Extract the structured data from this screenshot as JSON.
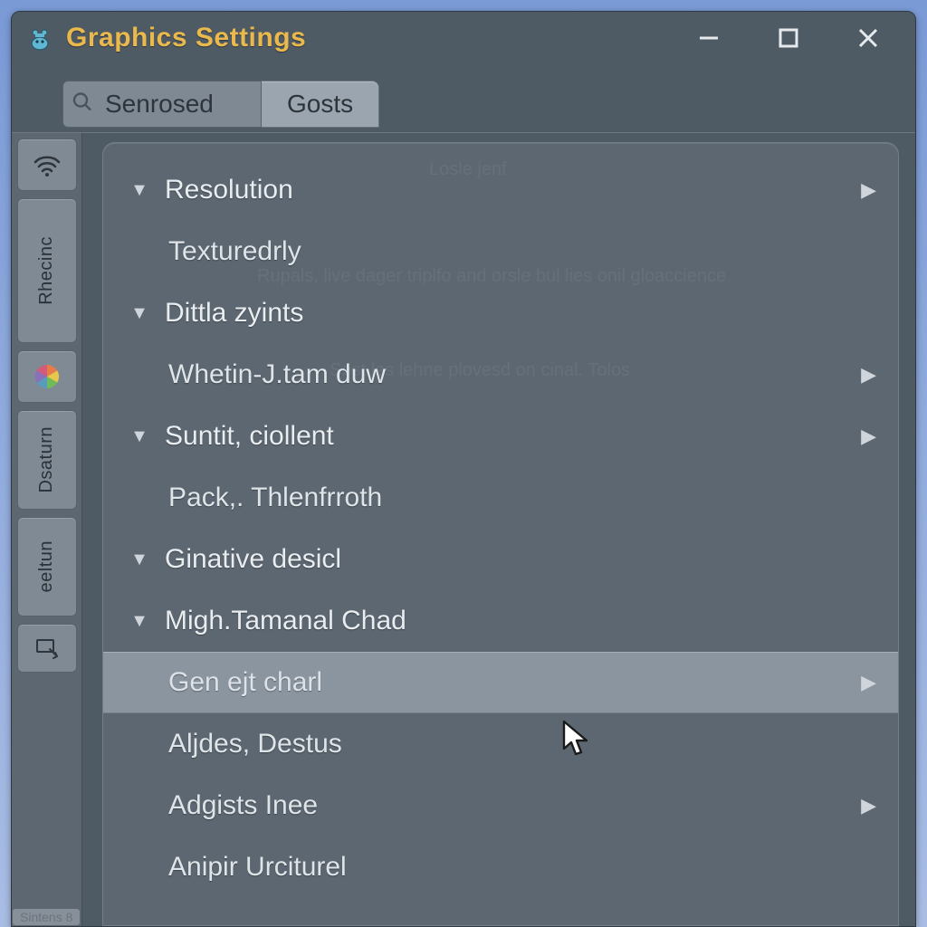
{
  "window": {
    "title": "Graphics Settings"
  },
  "search": {
    "value": "Senrosed"
  },
  "tabs": {
    "active_index": 0,
    "items": [
      {
        "label": "Gosts"
      }
    ]
  },
  "sidebar": {
    "items": [
      {
        "name": "wifi",
        "label": ""
      },
      {
        "name": "rhecinc",
        "label": "Rhecinc"
      },
      {
        "name": "color",
        "label": ""
      },
      {
        "name": "dsaturn",
        "label": "Dsaturn"
      },
      {
        "name": "eeltun",
        "label": "eeltun"
      },
      {
        "name": "desktop",
        "label": ""
      }
    ]
  },
  "settings": {
    "rows": [
      {
        "type": "group",
        "label": "Resolution",
        "has_arrow": true
      },
      {
        "type": "item",
        "label": "Texturedrly",
        "has_arrow": false
      },
      {
        "type": "group",
        "label": "Dittla zyints",
        "has_arrow": false
      },
      {
        "type": "item",
        "label": "Whetin-J.tam duw",
        "has_arrow": true
      },
      {
        "type": "group",
        "label": "Suntit, ciollent",
        "has_arrow": true
      },
      {
        "type": "item",
        "label": "Pack,. Thlenfrroth",
        "has_arrow": false
      },
      {
        "type": "group",
        "label": "Ginative desicl",
        "has_arrow": false
      },
      {
        "type": "group",
        "label": "Migh.Tamanal Chad",
        "has_arrow": false
      },
      {
        "type": "item",
        "label": "Gen ejt charl",
        "has_arrow": true,
        "selected": true
      },
      {
        "type": "item",
        "label": "Aljdes, Destus",
        "has_arrow": false
      },
      {
        "type": "item",
        "label": "Adgists Inee",
        "has_arrow": true
      },
      {
        "type": "item",
        "label": "Anipir Urciturel",
        "has_arrow": false
      }
    ]
  },
  "status": {
    "text": "Sintens  8"
  }
}
